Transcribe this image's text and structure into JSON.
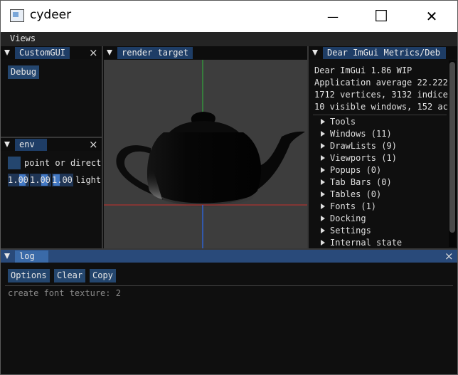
{
  "window": {
    "title": "cydeer",
    "minimize": "—",
    "maximize": "☐",
    "close": "✕"
  },
  "menu": {
    "views": "Views"
  },
  "custom_gui": {
    "tab": "CustomGUI",
    "debug_button": "Debug"
  },
  "env": {
    "tab": "env",
    "checkbox_label": "point or direct",
    "values": [
      "1.00",
      "1.00",
      "1.00"
    ],
    "light_label": "light"
  },
  "render": {
    "tab": "render target"
  },
  "metrics": {
    "tab": "Dear ImGui Metrics/Deb",
    "lines": [
      "Dear ImGui 1.86 WIP",
      "Application average 22.222",
      "1712 vertices, 3132 indice",
      "10 visible windows, 152 ac"
    ],
    "tree": [
      "Tools",
      "Windows (11)",
      "DrawLists (9)",
      "Viewports (1)",
      "Popups (0)",
      "Tab Bars (0)",
      "Tables (0)",
      "Fonts (1)",
      "Docking",
      "Settings",
      "Internal state"
    ]
  },
  "log": {
    "tab": "log",
    "options": "Options",
    "clear": "Clear",
    "copy": "Copy",
    "content": "create font texture: 2"
  },
  "colors": {
    "title_active": "#294a7a",
    "tab": "#3a6aa8",
    "button": "#24466e",
    "axis_x": "#c8302c",
    "axis_y": "#2fbb3a",
    "axis_z": "#2f62d0"
  }
}
